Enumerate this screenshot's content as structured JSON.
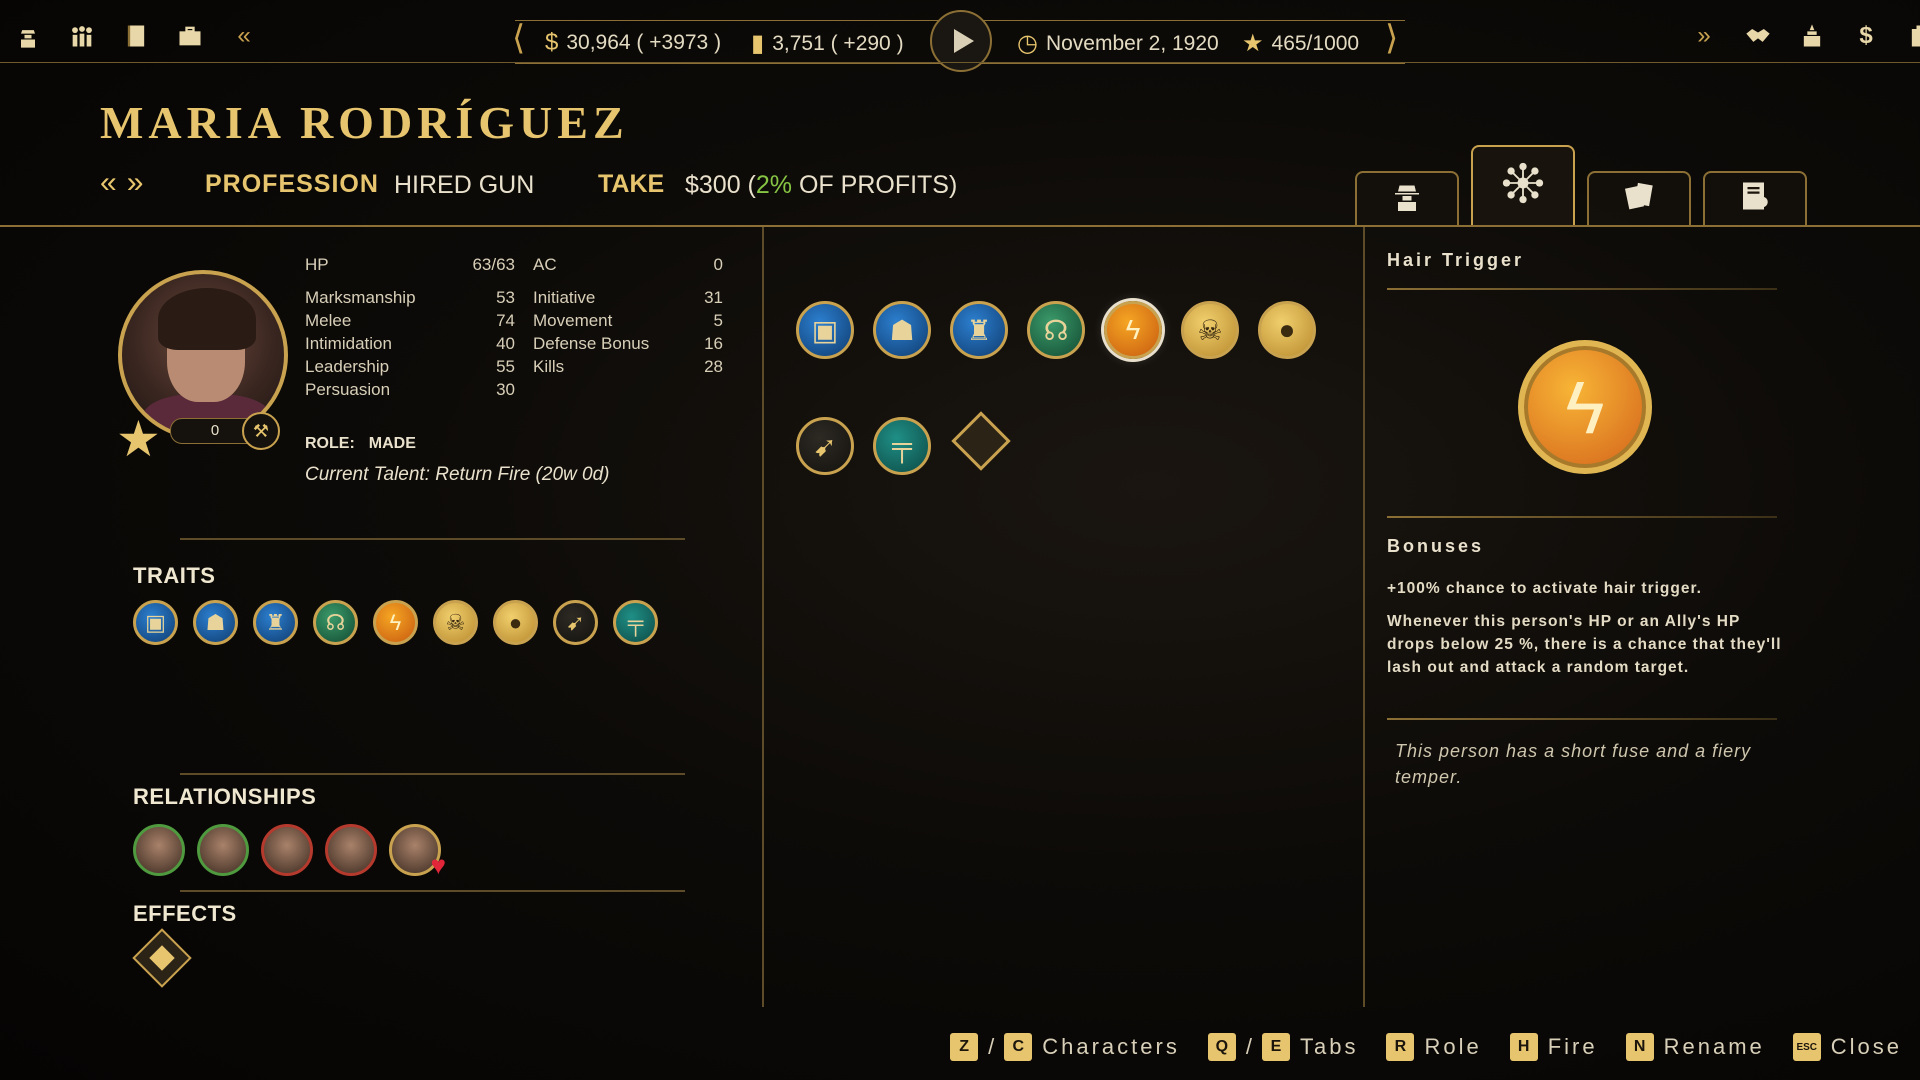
{
  "topbar": {
    "left_icons": [
      "mobster-icon",
      "crew-icon",
      "ledger-icon",
      "briefcase-icon",
      "collapse-left-icon"
    ],
    "right_icons": [
      "expand-right-icon",
      "handshake-icon",
      "city-hall-icon",
      "dollar-icon",
      "safe-icon"
    ],
    "money": "30,964 ( +3973 )",
    "booze": "3,751 ( +290 )",
    "date": "November 2, 1920",
    "heat": "465/1000"
  },
  "character": {
    "name": "MARIA RODRÍGUEZ",
    "profession_label": "PROFESSION",
    "profession_value": "HIRED GUN",
    "take_label": "TAKE",
    "take_amount": "$300 (",
    "take_percent": "2%",
    "take_suffix": " OF PROFITS)",
    "level": "0",
    "role_label": "ROLE:",
    "role_value": "MADE",
    "current_talent": "Current Talent: Return Fire (20w 0d)"
  },
  "tabs": [
    {
      "name": "tab-profile",
      "icon": "fedora-man-icon"
    },
    {
      "name": "tab-talents",
      "icon": "talent-tree-icon",
      "active": true
    },
    {
      "name": "tab-cards",
      "icon": "cards-icon"
    },
    {
      "name": "tab-dossier",
      "icon": "dossier-icon"
    }
  ],
  "stats_left": [
    {
      "name": "HP",
      "value": "63/63"
    },
    {
      "name": "Marksmanship",
      "value": "53"
    },
    {
      "name": "Melee",
      "value": "74"
    },
    {
      "name": "Intimidation",
      "value": "40"
    },
    {
      "name": "Leadership",
      "value": "55"
    },
    {
      "name": "Persuasion",
      "value": "30"
    }
  ],
  "stats_right": [
    {
      "name": "AC",
      "value": "0"
    },
    {
      "name": "Initiative",
      "value": "31"
    },
    {
      "name": "Movement",
      "value": "5"
    },
    {
      "name": "Defense Bonus",
      "value": "16"
    },
    {
      "name": "Kills",
      "value": "28"
    }
  ],
  "sections": {
    "traits": "TRAITS",
    "relationships": "RELATIONSHIPS",
    "effects": "EFFECTS"
  },
  "traits": [
    {
      "icon": "suitcase-icon",
      "color": "blue"
    },
    {
      "icon": "gangster-icon",
      "color": "blue"
    },
    {
      "icon": "liberty-icon",
      "color": "blue"
    },
    {
      "icon": "speaker-icon",
      "color": "green"
    },
    {
      "icon": "lightning-icon",
      "color": "orange"
    },
    {
      "icon": "skull-icon",
      "color": "gold"
    },
    {
      "icon": "bald-head-icon",
      "color": "gold"
    },
    {
      "icon": "running-man-icon",
      "color": "dark"
    },
    {
      "icon": "tommy-gun-icon",
      "color": "teal"
    }
  ],
  "relationships": [
    {
      "border": "green"
    },
    {
      "border": "green"
    },
    {
      "border": "red"
    },
    {
      "border": "red"
    },
    {
      "border": "gold",
      "heart": true
    }
  ],
  "talents_row1": [
    {
      "icon": "suitcase-icon",
      "color": "blue"
    },
    {
      "icon": "gangster-icon",
      "color": "blue"
    },
    {
      "icon": "liberty-icon",
      "color": "blue"
    },
    {
      "icon": "speaker-icon",
      "color": "green"
    },
    {
      "icon": "lightning-icon",
      "color": "orange",
      "selected": true
    },
    {
      "icon": "skull-icon",
      "color": "gold"
    },
    {
      "icon": "bald-head-icon",
      "color": "gold"
    }
  ],
  "talents_row2": [
    {
      "icon": "running-man-icon",
      "color": "dark"
    },
    {
      "icon": "tommy-gun-icon",
      "color": "teal"
    }
  ],
  "detail": {
    "title": "Hair Trigger",
    "bonuses_title": "Bonuses",
    "bonus_1": "+100% chance to activate hair trigger.",
    "bonus_2": "Whenever this person's HP or an Ally's HP drops below 25 %, there is a chance that they'll lash out and attack a random target.",
    "flavor": "This person has a short fuse and a fiery temper."
  },
  "controls": {
    "k_z": "Z",
    "k_c": "C",
    "characters": "Characters",
    "k_q": "Q",
    "k_e": "E",
    "tabs": "Tabs",
    "k_r": "R",
    "role": "Role",
    "k_h": "H",
    "fire": "Fire",
    "k_n": "N",
    "rename": "Rename",
    "k_esc": "ESC",
    "close": "Close",
    "slash": "/"
  },
  "colors": {
    "accent_gold": "#e7c56e",
    "take_percent_green": "#86c443",
    "border_gold": "#8b6f35"
  }
}
